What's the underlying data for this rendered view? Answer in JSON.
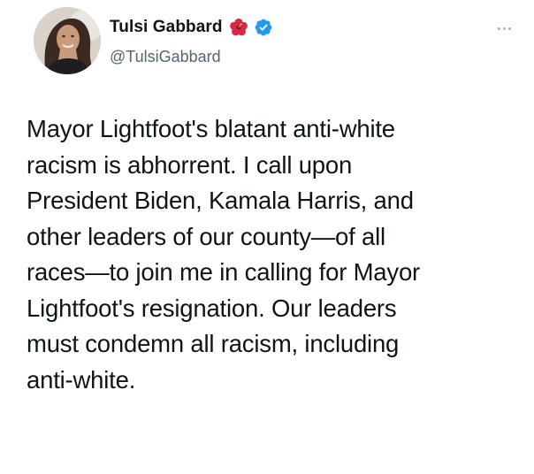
{
  "tweet": {
    "author": {
      "display_name": "Tulsi Gabbard",
      "handle": "@TulsiGabbard",
      "name_emoji": "hibiscus-flower-icon",
      "verified": true,
      "verified_color": "#1d9bf0"
    },
    "more_label": "···",
    "text_lines": [
      "Mayor Lightfoot's blatant anti-white",
      "racism is abhorrent. I call upon",
      "President Biden, Kamala Harris, and",
      "other leaders of our county—of all",
      "races—to join me in calling for Mayor",
      "Lightfoot's resignation. Our leaders",
      "must condemn all racism, including",
      "anti-white."
    ]
  },
  "colors": {
    "text": "#0f1419",
    "secondary_text": "#536471",
    "flower": "#d42a48"
  }
}
